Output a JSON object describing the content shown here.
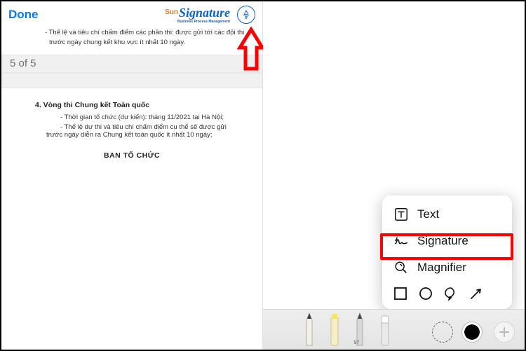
{
  "toolbar": {
    "done": "Done",
    "brand_prefix": "Sun",
    "brand": "Signature",
    "brand_tag": "Business Process Management"
  },
  "doc": {
    "top_bullet": "- Thể lệ và tiêu chí chấm điểm các phần thi: được gửi tới các đội thi trước ngày chung kết khu vực ít nhất 10 ngày.",
    "page_counter": "5 of 5",
    "section_heading": "4.  Vòng thi Chung kết Toàn quốc",
    "line1": "- Thời gian tổ chức (dự kiến): tháng 11/2021 tại Hà Nội;",
    "line2": "- Thể lệ dự thi và tiêu chí chấm điểm cụ thể sẽ được gửi trước ngày diễn ra Chung kết toàn quốc ít nhất 10 ngày;",
    "signer": "BAN TỔ CHỨC"
  },
  "popover": {
    "text": "Text",
    "signature": "Signature",
    "magnifier": "Magnifier"
  },
  "tools": {
    "pencil_label": "97"
  }
}
